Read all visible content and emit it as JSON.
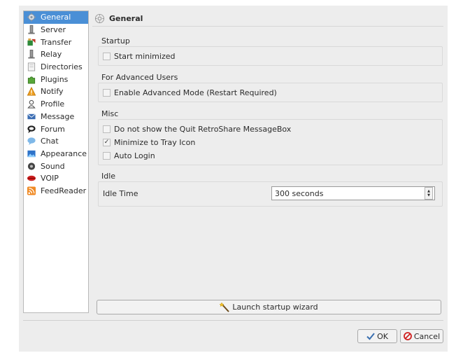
{
  "sidebar": {
    "items": [
      {
        "label": "General",
        "icon": "gear-icon",
        "selected": true
      },
      {
        "label": "Server",
        "icon": "server-icon"
      },
      {
        "label": "Transfer",
        "icon": "transfer-icon"
      },
      {
        "label": "Relay",
        "icon": "relay-icon"
      },
      {
        "label": "Directories",
        "icon": "folder-icon"
      },
      {
        "label": "Plugins",
        "icon": "puzzle-icon"
      },
      {
        "label": "Notify",
        "icon": "warning-icon"
      },
      {
        "label": "Profile",
        "icon": "person-icon"
      },
      {
        "label": "Message",
        "icon": "message-icon"
      },
      {
        "label": "Forum",
        "icon": "forum-icon"
      },
      {
        "label": "Chat",
        "icon": "chat-icon"
      },
      {
        "label": "Appearance",
        "icon": "appearance-icon"
      },
      {
        "label": "Sound",
        "icon": "speaker-icon"
      },
      {
        "label": "VOIP",
        "icon": "voip-lips-icon"
      },
      {
        "label": "FeedReader",
        "icon": "rss-icon"
      }
    ]
  },
  "header": {
    "title": "General",
    "icon": "gear-icon"
  },
  "startup": {
    "title": "Startup",
    "start_minimized": {
      "label": "Start minimized",
      "checked": false
    }
  },
  "advanced": {
    "title": "For Advanced Users",
    "enable_advanced": {
      "label": "Enable Advanced Mode (Restart Required)",
      "checked": false
    }
  },
  "misc": {
    "title": "Misc",
    "no_quit_box": {
      "label": "Do not show the Quit RetroShare MessageBox",
      "checked": false
    },
    "minimize_tray": {
      "label": "Minimize to Tray Icon",
      "checked": true
    },
    "auto_login": {
      "label": "Auto Login",
      "checked": false
    }
  },
  "idle": {
    "title": "Idle",
    "label": "Idle Time",
    "value": "300 seconds"
  },
  "wizard_button": {
    "label": "Launch startup wizard",
    "icon": "magic-wand-icon"
  },
  "buttons": {
    "ok": {
      "label": "OK",
      "icon": "checkmark-icon"
    },
    "cancel": {
      "label": "Cancel",
      "icon": "cancel-icon"
    }
  },
  "colors": {
    "selection": "#4a8fd6",
    "window_bg": "#ededed"
  }
}
